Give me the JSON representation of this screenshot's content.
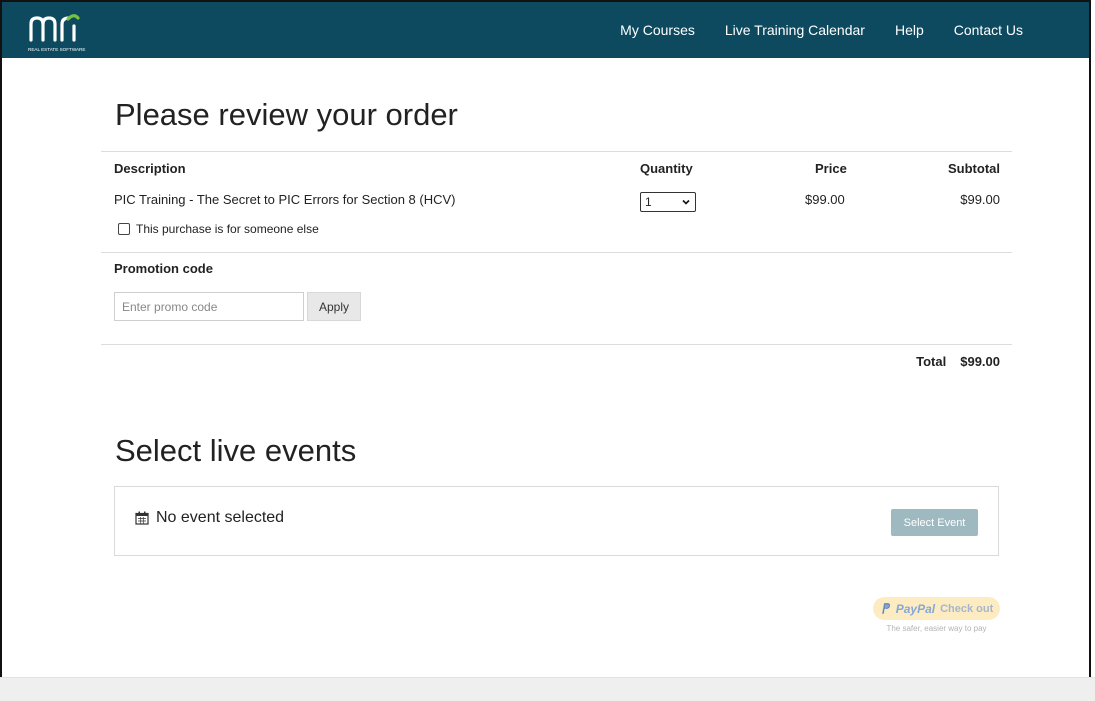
{
  "header": {
    "logo_text": "mri",
    "logo_subtext": "REAL ESTATE SOFTWARE",
    "nav": [
      "My Courses",
      "Live Training Calendar",
      "Help",
      "Contact Us"
    ]
  },
  "order": {
    "title": "Please review your order",
    "columns": {
      "description": "Description",
      "quantity": "Quantity",
      "price": "Price",
      "subtotal": "Subtotal"
    },
    "item": {
      "description": "PIC Training - The Secret to PIC Errors for Section 8 (HCV)",
      "quantity": "1",
      "price": "$99.00",
      "subtotal": "$99.00"
    },
    "someone_else_label": "This purchase is for someone else",
    "promo": {
      "label": "Promotion code",
      "placeholder": "Enter promo code",
      "apply": "Apply"
    },
    "total": {
      "label": "Total",
      "value": "$99.00"
    }
  },
  "events": {
    "title": "Select live events",
    "empty_text": "No event selected",
    "select_button": "Select Event"
  },
  "paypal": {
    "word": "PayPal",
    "action": "Check out",
    "tagline": "The safer, easier way to pay"
  },
  "colors": {
    "header_bg": "#0d4a60",
    "logo_green": "#7ac143",
    "button_disabled": "#9fb9c1"
  }
}
